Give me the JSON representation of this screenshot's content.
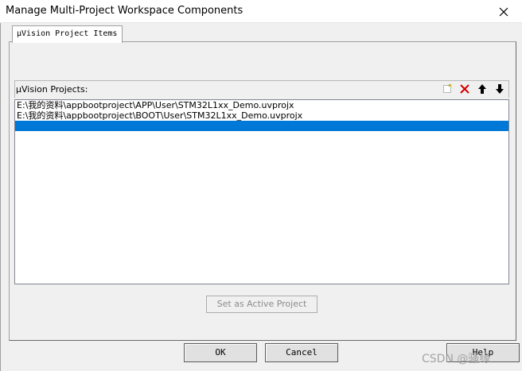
{
  "window": {
    "title": "Manage Multi-Project Workspace Components"
  },
  "tabs": [
    {
      "label": "µVision Project Items"
    }
  ],
  "projects_group": {
    "label": "µVision Projects:",
    "toolbar": [
      {
        "icon": "new-icon"
      },
      {
        "icon": "delete-icon"
      },
      {
        "icon": "move-up-icon"
      },
      {
        "icon": "move-down-icon"
      }
    ]
  },
  "projects": [
    {
      "path": "E:\\我的资料\\appbootproject\\APP\\User\\STM32L1xx_Demo.uvprojx",
      "selected": false
    },
    {
      "path": "E:\\我的资料\\appbootproject\\BOOT\\User\\STM32L1xx_Demo.uvprojx",
      "selected": false
    },
    {
      "path": "",
      "selected": true
    }
  ],
  "buttons": {
    "set_active": "Set as Active Project",
    "ok": "OK",
    "cancel": "Cancel",
    "help": "Help"
  },
  "watermark": "CSDN @骚缘",
  "colors": {
    "selection": "#0078d7",
    "delete_icon": "#d40000"
  }
}
